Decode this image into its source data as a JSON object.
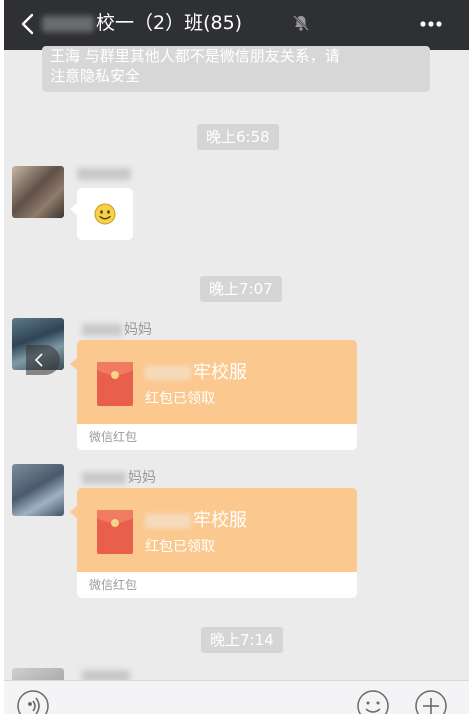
{
  "header": {
    "title": "校一（2）班(85)",
    "icons": {
      "back": "back-arrow-icon",
      "mute": "bell-muted-icon",
      "more": "more-dots-icon"
    }
  },
  "notice": {
    "line1": "王海 与群里其他人都不是微信朋友关系，请",
    "line2": "注意隐私安全"
  },
  "times": {
    "t1": "晚上6:58",
    "t2": "晚上7:07",
    "t3": "晚上7:14"
  },
  "messages": {
    "emoji": {
      "icon": "smiley-emoji-icon"
    },
    "packet1": {
      "sender_suffix": "妈妈",
      "title_suffix": "牢校服",
      "status": "红包已领取",
      "footer": "微信红包"
    },
    "packet2": {
      "sender_suffix": "妈妈",
      "title_suffix": "牢校服",
      "status": "红包已领取",
      "footer": "微信红包"
    }
  },
  "colors": {
    "header_bg": "#2f3034",
    "chat_bg": "#ebebeb",
    "packet_orange": "#fbc88f",
    "envelope_red": "#e8604c"
  },
  "bottom_bar": {
    "icons": [
      "voice-icon",
      "emoji-face-icon",
      "plus-icon"
    ]
  }
}
